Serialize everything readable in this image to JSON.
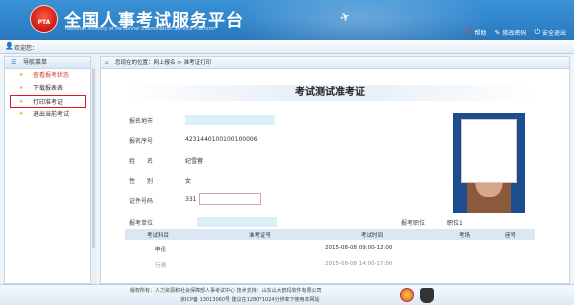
{
  "header": {
    "logo_text": "PTA",
    "title": "全国人事考试服务平台",
    "subtitle": "National Ministry of Personnel Examination Service Platform",
    "links": [
      {
        "icon": "help-icon",
        "label": "帮助"
      },
      {
        "icon": "edit-password-icon",
        "label": "修改密码"
      },
      {
        "icon": "logout-icon",
        "label": "安全退出"
      }
    ]
  },
  "welcome": {
    "text": "欢迎您："
  },
  "sidebar": {
    "title": "导航菜单",
    "items": [
      {
        "label": "查看报考状态"
      },
      {
        "label": "下载报表表"
      },
      {
        "label": "打印准考证"
      },
      {
        "label": "退出当前考试"
      }
    ]
  },
  "breadcrumb": {
    "text": "您现在的位置：网上报名 > 准考证打印"
  },
  "card": {
    "title": "考试测试准考证",
    "fields": {
      "site_label": "报名地市",
      "serial_label": "报名序号",
      "serial_value": "4231440100100100006",
      "name_label": "姓　　名",
      "name_value": "纪雪蓉",
      "gender_label": "性　　别",
      "gender_value": "女",
      "id_label": "证件号码",
      "id_value": "331",
      "unit_label": "报考单位",
      "position_label": "报考职位",
      "position_value": "职位1"
    }
  },
  "schedule": {
    "headers": [
      "考试科目",
      "准考证号",
      "考试时间",
      "考场",
      "座号"
    ],
    "rows": [
      {
        "subject": "申论",
        "ticket": "",
        "time": "2015-08-08 09:00-12:00",
        "room": "",
        "seat": ""
      },
      {
        "subject": "行测",
        "ticket": "",
        "time": "2015-08-08 14:00-17:00",
        "room": "",
        "seat": ""
      }
    ]
  },
  "footer": {
    "line1": "版权所有：人力资源和社会保障部人事考试中心  技术支持：山东山大鸥玛软件有限公司",
    "line2": "京ICP备 13013060号  建议在1280*1024分辨率下使用本网站"
  }
}
